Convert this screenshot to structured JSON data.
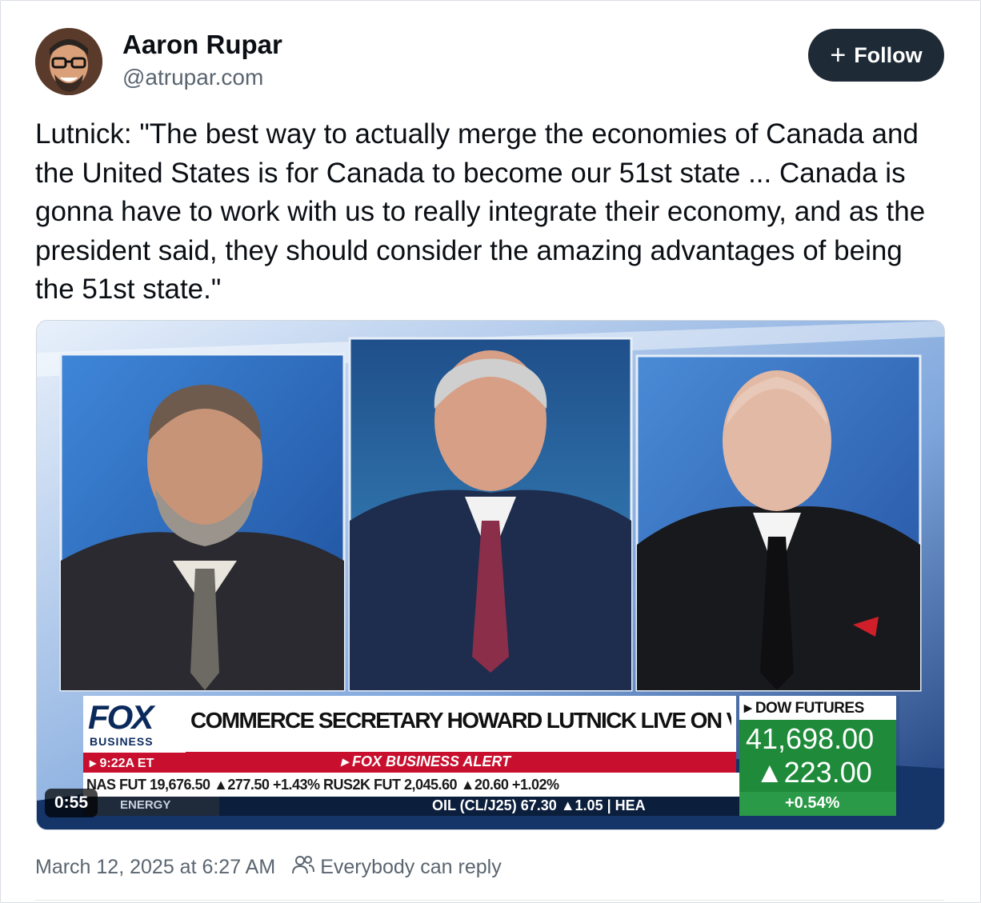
{
  "author": {
    "display_name": "Aaron Rupar",
    "handle": "@atrupar.com"
  },
  "follow_button": {
    "plus": "+",
    "label": "Follow"
  },
  "post": {
    "text": "Lutnick: \"The best way to actually merge the economies of Canada and the United States is for Canada to become our 51st state ... Canada is gonna have to work with us to really integrate their economy, and as the president said, they should consider the amazing advantages of being the 51st state.\""
  },
  "video": {
    "duration": "0:55",
    "chyron": {
      "logo": "FOX",
      "logo_sub": "BUSINESS",
      "time": "▸ 9:22A ET",
      "headline": "COMMERCE SECRETARY HOWARD LUTNICK LIVE ON VARNEY",
      "alert": "▸ FOX BUSINESS ALERT",
      "ticker_row1": "NAS FUT  19,676.50 ▲277.50 +1.43%  RUS2K FUT  2,045.60 ▲20.60 +1.02%",
      "ticker_row2_label": "ENERGY",
      "ticker_row2": "OIL (CL/J25)  67.30  ▲1.05  |  HEA",
      "dow_label": "▸ DOW FUTURES",
      "dow_value": "41,698.00",
      "dow_change": "▲223.00",
      "dow_pct": "+0.54%"
    },
    "colors": {
      "chyron_red": "#c8102e",
      "dow_green": "#1e8a3a",
      "navy": "#0b2a5c"
    }
  },
  "footer": {
    "timestamp": "March 12, 2025 at 6:27 AM",
    "reply_setting": "Everybody can reply"
  }
}
